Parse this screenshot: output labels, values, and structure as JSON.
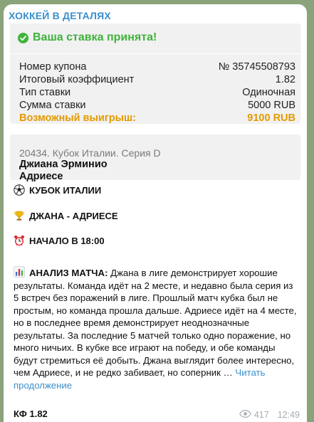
{
  "channel": {
    "name": "ХОККЕЙ В ДЕТАЛЯХ"
  },
  "bet": {
    "accepted_text": "Ваша ставка принята!",
    "rows": [
      {
        "label": "Номер купона",
        "value": "№ 35745508793"
      },
      {
        "label": "Итоговый коэффициент",
        "value": "1.82"
      },
      {
        "label": "Тип ставки",
        "value": "Одиночная"
      },
      {
        "label": "Сумма ставки",
        "value": "5000 RUB"
      },
      {
        "label": "Возможный выигрыш:",
        "value": "9100 RUB"
      }
    ]
  },
  "match_card": {
    "tournament": "20434. Кубок Италии. Серия D",
    "team1": "Джиана Эрминио",
    "team2": "Адриесе"
  },
  "post": {
    "cup": "КУБОК ИТАЛИИ",
    "teams": "ДЖАНА - АДРИЕСЕ",
    "start": "НАЧАЛО В 18:00",
    "analysis_head": "АНАЛИЗ МАТЧА:",
    "analysis_body": " Джана в лиге демонстрирует хорошие результаты. Команда идёт на 2 месте, и недавно была серия из 5 встреч без поражений в лиге. Прошлый матч кубка был не простым, но команда прошла дальше. Адриесе идёт на 4 месте, но в последнее время демонстрирует неоднозначные результаты. За последние 5 матчей только одно поражение, но много ничьих. В кубке все играют на победу, и обе команды будут стремиться её добыть. Джана выглядит более интересно, чем Адриесе, и не редко забивает, но соперник … ",
    "read_more": "Читать продолжение",
    "kf": "КФ 1.82"
  },
  "meta": {
    "views": "417",
    "time": "12:49"
  },
  "colors": {
    "accent": "#3a8fce",
    "success": "#3fb33a",
    "win": "#e39a00"
  }
}
